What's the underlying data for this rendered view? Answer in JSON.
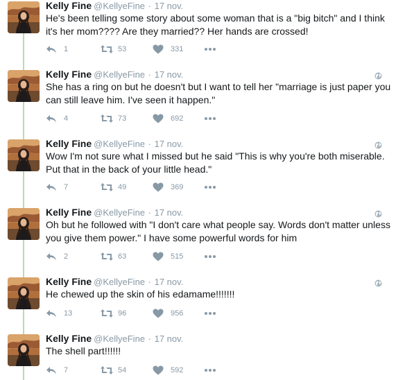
{
  "colors": {
    "name": "#14171a",
    "meta": "#8899a6",
    "action": "#8899a6",
    "thread_line": "#b9dca8",
    "background": "#ffffff"
  },
  "icons": {
    "reply": "reply-icon",
    "retweet": "retweet-icon",
    "like": "heart-icon",
    "more": "more-icon",
    "visibility": "globe-icon",
    "avatar": "profile-photo"
  },
  "tweets": [
    {
      "name": "Kelly Fine",
      "handle": "@KellyeFine",
      "date": "17 nov.",
      "text": "He's been telling some story about some woman that is a \"big bitch\" and I think it's her mom???? Are they married?? Her hands are crossed!",
      "replies": "1",
      "retweets": "53",
      "likes": "331"
    },
    {
      "name": "Kelly Fine",
      "handle": "@KellyeFine",
      "date": "17 nov.",
      "text": "She has a ring on but he doesn't but I want to tell her \"marriage is just paper you can still leave him. I've seen it happen.\"",
      "replies": "4",
      "retweets": "73",
      "likes": "692"
    },
    {
      "name": "Kelly Fine",
      "handle": "@KellyeFine",
      "date": "17 nov.",
      "text": "Wow I'm not sure what I missed but he said \"This is why you're both miserable. Put that in the back of your little head.\"",
      "replies": "7",
      "retweets": "49",
      "likes": "369"
    },
    {
      "name": "Kelly Fine",
      "handle": "@KellyeFine",
      "date": "17 nov.",
      "text": "Oh but he followed with \"I don't care what people say. Words don't matter unless you give them power.\" I have some powerful words for him",
      "replies": "2",
      "retweets": "63",
      "likes": "515"
    },
    {
      "name": "Kelly Fine",
      "handle": "@KellyeFine",
      "date": "17 nov.",
      "text": "He chewed up the skin of his edamame!!!!!!!",
      "replies": "13",
      "retweets": "96",
      "likes": "956"
    },
    {
      "name": "Kelly Fine",
      "handle": "@KellyeFine",
      "date": "17 nov.",
      "text": "The shell part!!!!!!",
      "replies": "7",
      "retweets": "54",
      "likes": "592"
    }
  ]
}
